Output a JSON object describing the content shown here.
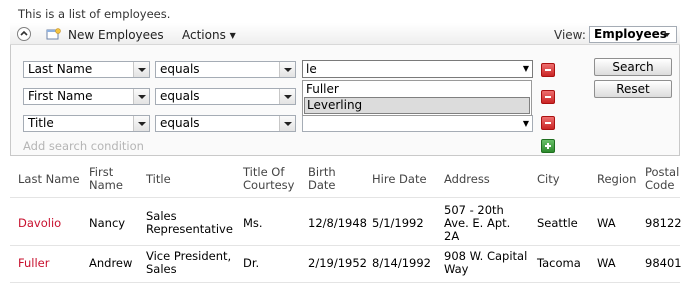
{
  "description": "This is a list of employees.",
  "toolbar": {
    "new_label": "New Employees",
    "actions_label": "Actions",
    "view_label": "View:",
    "view_value": "Employees"
  },
  "search": {
    "conditions": [
      {
        "field": "Last Name",
        "operator": "equals",
        "value": "le"
      },
      {
        "field": "First Name",
        "operator": "equals",
        "value": ""
      },
      {
        "field": "Title",
        "operator": "equals",
        "value": ""
      }
    ],
    "suggestions": [
      "Fuller",
      "Leverling"
    ],
    "highlighted_suggestion": "Leverling",
    "add_condition_label": "Add search condition",
    "search_button": "Search",
    "reset_button": "Reset"
  },
  "table": {
    "headers": {
      "last_name": "Last Name",
      "first_name": [
        "First",
        "Name"
      ],
      "title": "Title",
      "courtesy": [
        "Title Of",
        "Courtesy"
      ],
      "birth": [
        "Birth",
        "Date"
      ],
      "hire": "Hire Date",
      "address": "Address",
      "city": "City",
      "region": "Region",
      "postal": [
        "Postal",
        "Code"
      ]
    },
    "rows": [
      {
        "last_name": "Davolio",
        "first_name": "Nancy",
        "title": [
          "Sales",
          "Representative"
        ],
        "courtesy": "Ms.",
        "birth": "12/8/1948",
        "hire": "5/1/1992",
        "address": [
          "507 - 20th",
          "Ave. E. Apt.",
          "2A"
        ],
        "city": "Seattle",
        "region": "WA",
        "postal": "98122"
      },
      {
        "last_name": "Fuller",
        "first_name": "Andrew",
        "title": [
          "Vice President,",
          "Sales"
        ],
        "courtesy": "Dr.",
        "birth": "2/19/1952",
        "hire": "8/14/1992",
        "address": [
          "908 W. Capital",
          "Way"
        ],
        "city": "Tacoma",
        "region": "WA",
        "postal": "98401"
      }
    ]
  },
  "colors": {
    "link": "#c8102e",
    "remove": "#d33333",
    "add": "#3f9b3f"
  }
}
